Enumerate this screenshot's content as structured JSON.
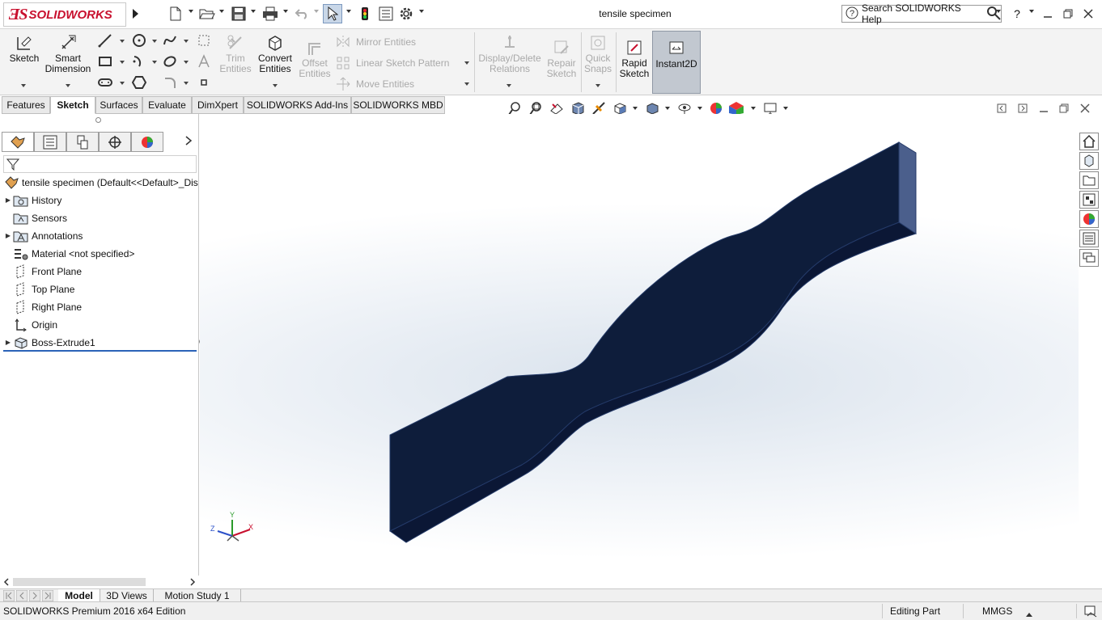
{
  "app": {
    "brand": "SOLIDWORKS",
    "document_title": "tensile specimen",
    "search_placeholder": "Search SOLIDWORKS Help",
    "help_label": "?"
  },
  "command_manager": {
    "sketch": "Sketch",
    "smart_dimension": [
      "Smart",
      "Dimension"
    ],
    "trim_entities": [
      "Trim",
      "Entities"
    ],
    "convert_entities": [
      "Convert",
      "Entities"
    ],
    "offset_entities": [
      "Offset",
      "Entities"
    ],
    "mirror_entities": "Mirror Entities",
    "linear_sketch_pattern": "Linear Sketch Pattern",
    "move_entities": "Move Entities",
    "display_delete_relations": [
      "Display/Delete",
      "Relations"
    ],
    "repair_sketch": [
      "Repair",
      "Sketch"
    ],
    "quick_snaps": [
      "Quick",
      "Snaps"
    ],
    "rapid_sketch": [
      "Rapid",
      "Sketch"
    ],
    "instant2d": "Instant2D"
  },
  "tabs": [
    "Features",
    "Sketch",
    "Surfaces",
    "Evaluate",
    "DimXpert",
    "SOLIDWORKS Add-Ins",
    "SOLIDWORKS MBD"
  ],
  "active_tab": "Sketch",
  "feature_tree": {
    "root": "tensile specimen  (Default<<Default>_Dis",
    "items": [
      {
        "label": "History",
        "expandable": true
      },
      {
        "label": "Sensors",
        "expandable": false
      },
      {
        "label": "Annotations",
        "expandable": true
      },
      {
        "label": "Material <not specified>",
        "expandable": false
      },
      {
        "label": "Front Plane",
        "expandable": false
      },
      {
        "label": "Top Plane",
        "expandable": false
      },
      {
        "label": "Right Plane",
        "expandable": false
      },
      {
        "label": "Origin",
        "expandable": false
      },
      {
        "label": "Boss-Extrude1",
        "expandable": true
      }
    ]
  },
  "triad": {
    "x": "X",
    "y": "Y",
    "z": "Z"
  },
  "bottom_tabs": [
    "Model",
    "3D Views",
    "Motion Study 1"
  ],
  "active_bottom_tab": "Model",
  "status": {
    "edition": "SOLIDWORKS Premium 2016 x64 Edition",
    "mode": "Editing Part",
    "units": "MMGS"
  },
  "colors": {
    "part": "#0e1d3b",
    "part_edge": "#243a68",
    "brand_red": "#c8102e",
    "highlight": "#c9d7e8"
  }
}
